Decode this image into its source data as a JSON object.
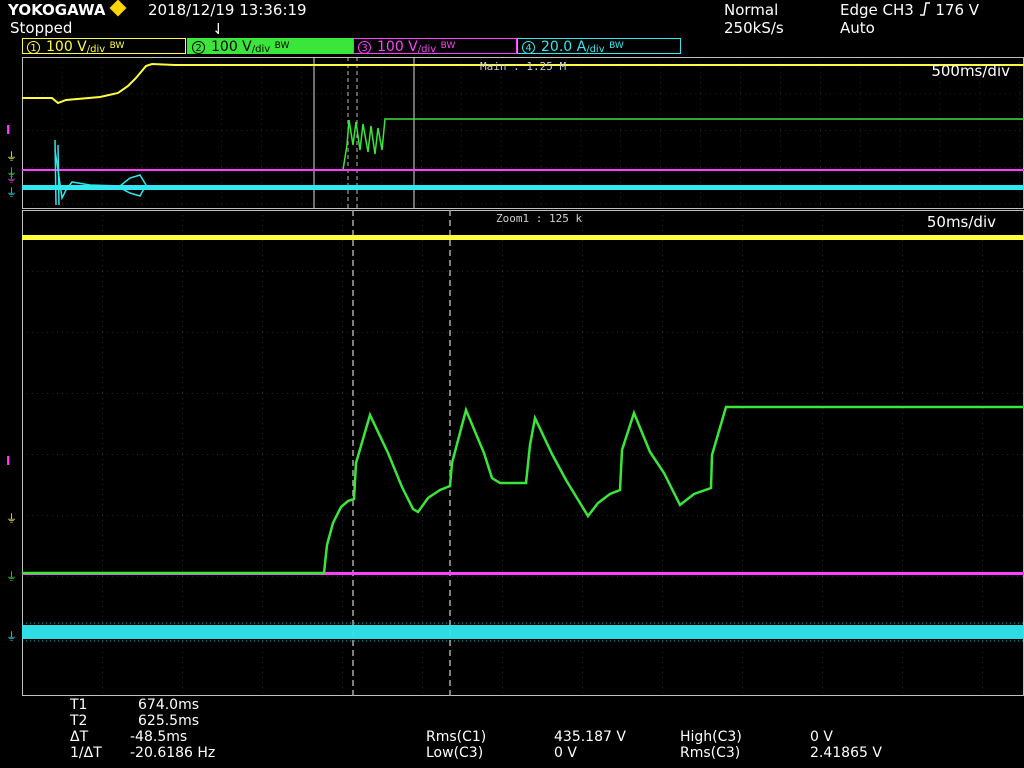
{
  "header": {
    "brand": "YOKOGAWA",
    "status": "Stopped",
    "datetime": "2018/12/19  13:36:19",
    "cursor_glyph": "⇃",
    "acq_mode": "Normal",
    "sample_rate": "250kS/s",
    "trigger": {
      "type": "Edge",
      "source": "CH3",
      "slope_icon": "rising-edge-icon",
      "level": "176 V",
      "mode": "Auto"
    }
  },
  "channels": [
    {
      "num": "1",
      "scale": "100 V",
      "unit_suffix": "/div",
      "bw": "BW",
      "color": "#ffff40"
    },
    {
      "num": "2",
      "scale": "100 V",
      "unit_suffix": "/div",
      "bw": "BW",
      "color": "#39e639"
    },
    {
      "num": "3",
      "scale": "100 V",
      "unit_suffix": "/div",
      "bw": "BW",
      "color": "#ff40ff"
    },
    {
      "num": "4",
      "scale": "20.0 A",
      "unit_suffix": "/div",
      "bw": "BW",
      "color": "#30e8f0"
    }
  ],
  "main_window": {
    "label": "Main : 1.25 M",
    "timebase": "500ms/div"
  },
  "zoom_window": {
    "label": "Zoom1 : 125 k",
    "timebase": "50ms/div"
  },
  "cursors": {
    "T1": "674.0ms",
    "T2": "625.5ms",
    "dT": "-48.5ms",
    "inv_dT": "-20.6186 Hz",
    "labels": {
      "t1": "T1",
      "t2": "T2",
      "dt": "ΔT",
      "inv_dt": "1/ΔT"
    }
  },
  "measurements": [
    {
      "name": "Rms(C1)",
      "value": "435.187 V"
    },
    {
      "name": "High(C3)",
      "value": "0 V"
    },
    {
      "name": "Low(C3)",
      "value": "0 V"
    },
    {
      "name": "Rms(C3)",
      "value": "2.41865 V"
    }
  ],
  "colors": {
    "grid": "#3a3a3a",
    "frame": "#bfbfbf",
    "ch1": "#ffff40",
    "ch2": "#39e639",
    "ch3": "#ff40ff",
    "ch4": "#30e8f0"
  }
}
